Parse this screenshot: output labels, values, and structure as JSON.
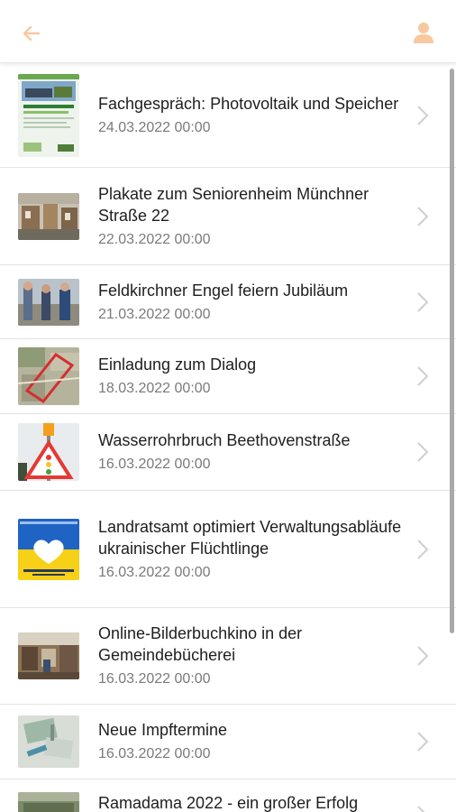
{
  "header": {
    "back_icon": "arrow-left-icon",
    "profile_icon": "user-icon",
    "accent_color": "#f6b27a"
  },
  "news": [
    {
      "title": "Fachgespräch: Photovoltaik und Speicher",
      "date": "24.03.2022 00:00",
      "thumb": "poster-photovoltaik"
    },
    {
      "title": "Plakate zum Seniorenheim Münchner Straße 22",
      "date": "22.03.2022 00:00",
      "thumb": "building-photo"
    },
    {
      "title": "Feldkirchner Engel feiern Jubiläum",
      "date": "21.03.2022 00:00",
      "thumb": "people-photo"
    },
    {
      "title": "Einladung zum Dialog",
      "date": "18.03.2022 00:00",
      "thumb": "aerial-map"
    },
    {
      "title": "Wasserrohrbruch Beethovenstraße",
      "date": "16.03.2022 00:00",
      "thumb": "warning-sign"
    },
    {
      "title": "Landratsamt optimiert Verwaltungsabläufe ukrainischer Flüchtlinge",
      "date": "16.03.2022 00:00",
      "thumb": "ukraine-heart"
    },
    {
      "title": "Online-Bilderbuchkino in der Gemeindebücherei",
      "date": "16.03.2022 00:00",
      "thumb": "library-photo"
    },
    {
      "title": "Neue Impftermine",
      "date": "16.03.2022 00:00",
      "thumb": "vaccine-photo"
    },
    {
      "title": "Ramadama 2022 - ein großer Erfolg",
      "date": "",
      "thumb": "cleanup-photo"
    }
  ]
}
